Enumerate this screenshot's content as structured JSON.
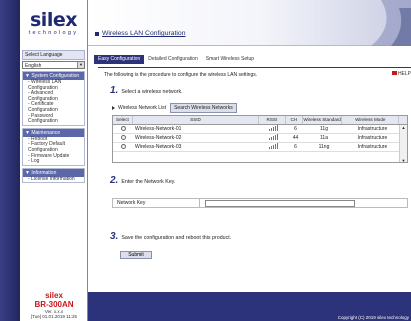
{
  "sidebar": {
    "brand": "silex",
    "tagline": "technology",
    "language_label": "Select Language",
    "language_value": "English",
    "nav": [
      {
        "header": "▼ System Configuration",
        "items": [
          "- Wireless LAN",
          "Configuration",
          "- Advanced",
          "Configuration",
          "- Certificate",
          "Configuration",
          "- Password",
          "Configuration"
        ]
      },
      {
        "header": "▼ Maintenance",
        "items": [
          "- Reboot",
          "- Factory Default",
          "Configuration",
          "- Firmware Update",
          "- Log"
        ]
      },
      {
        "header": "▼ Information",
        "items": [
          "- License Information"
        ]
      }
    ],
    "footer_brand": "silex",
    "model": "BR-300AN",
    "version": "Ver. x.x.x",
    "date": "[Tue] 01.01.2019 11:25"
  },
  "header": {
    "title": "Wireless LAN Configuration"
  },
  "tabs": [
    "Easy Configuration",
    "Detailed Configuration",
    "Smart Wireless Setup"
  ],
  "content": {
    "intro": "The following is the procedure to configure the wireless LAN settings.",
    "help": "HELP",
    "step1_num": "1.",
    "step1_text": "Select a wireless network.",
    "network_list_label": "Wireless Network List",
    "search_button": "Search Wireless Networks",
    "table": {
      "headers": [
        "Select",
        "SSID",
        "RSSI",
        "CH",
        "Wireless Standard",
        "Wireless Mode"
      ],
      "rows": [
        {
          "ssid": "Wireless-Network-01",
          "rssi": 5,
          "ch": "6",
          "std": "11g",
          "mode": "Infrastructure"
        },
        {
          "ssid": "Wireless-Network-02",
          "rssi": 5,
          "ch": "44",
          "std": "11a",
          "mode": "Infrastructure"
        },
        {
          "ssid": "Wireless-Network-03",
          "rssi": 5,
          "ch": "6",
          "std": "11ng",
          "mode": "Infrastructure"
        }
      ]
    },
    "step2_num": "2.",
    "step2_text": "Enter the Network Key.",
    "network_key_label": "Network Key",
    "network_key_value": "",
    "step3_num": "3.",
    "step3_text": "Save the configuration and reboot this product.",
    "submit_label": "Submit"
  },
  "footer": {
    "copyright": "Copyright (C) 2019 silex technology"
  },
  "colors": {
    "accent": "#2d337a",
    "brand_red": "#c8181e",
    "signal_green": "#3a9e3a"
  }
}
